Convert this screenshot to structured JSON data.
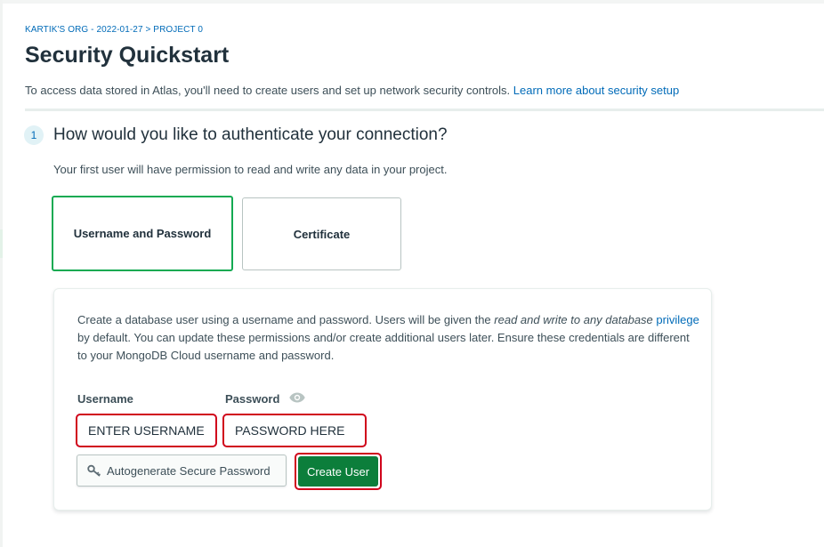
{
  "breadcrumb": "KARTIK'S ORG - 2022-01-27 > PROJECT 0",
  "page_title": "Security Quickstart",
  "intro": {
    "text": "To access data stored in Atlas, you'll need to create users and set up network security controls.",
    "link": "Learn more about security setup"
  },
  "step": {
    "number": "1",
    "title": "How would you like to authenticate your connection?",
    "description": "Your first user will have permission to read and write any data in your project."
  },
  "auth_options": [
    {
      "label": "Username and Password",
      "selected": true
    },
    {
      "label": "Certificate",
      "selected": false
    }
  ],
  "panel": {
    "text_1": "Create a database user using a username and password. Users will be given the",
    "text_italic": "read and write to any database",
    "text_link": "privilege",
    "text_2": "by default. You can update these permissions and/or create additional users later. Ensure these credentials are different to your MongoDB Cloud username and password.",
    "username_label": "Username",
    "password_label": "Password",
    "username_value": "ENTER USERNAME",
    "password_value": "PASSWORD HERE",
    "autogen_label": "Autogenerate Secure Password",
    "create_label": "Create User"
  },
  "colors": {
    "accent_green": "#13aa52",
    "button_green": "#0c7e3b",
    "link_blue": "#016bb8",
    "annotation_red": "#d0021b"
  },
  "icons": [
    "eye-icon",
    "key-icon"
  ]
}
